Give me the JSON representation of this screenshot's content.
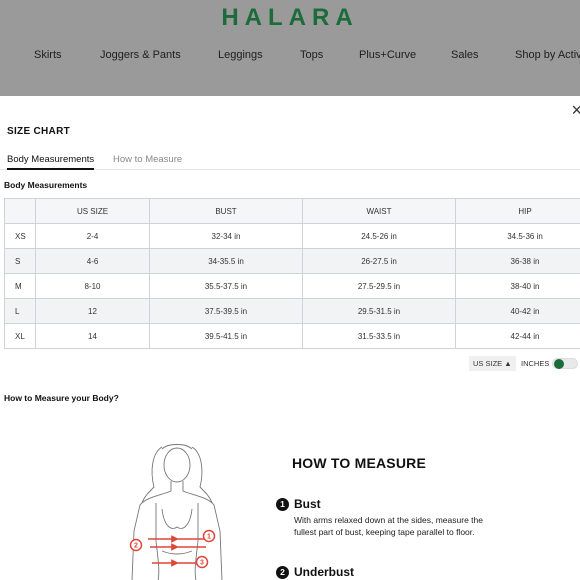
{
  "site": {
    "logo": "HALARA",
    "nav": [
      "Skirts",
      "Joggers & Pants",
      "Leggings",
      "Tops",
      "Plus+Curve",
      "Sales",
      "Shop by Activ"
    ]
  },
  "modal": {
    "close": "×",
    "title": "SIZE CHART",
    "tabs": [
      "Body Measurements",
      "How to Measure"
    ],
    "section_label": "Body Measurements",
    "table": {
      "headers": [
        "",
        "US SIZE",
        "BUST",
        "WAIST",
        "HIP"
      ],
      "rows": [
        [
          "XS",
          "2-4",
          "32-34 in",
          "24.5-26 in",
          "34.5-36 in"
        ],
        [
          "S",
          "4-6",
          "34-35.5 in",
          "26-27.5 in",
          "36-38 in"
        ],
        [
          "M",
          "8-10",
          "35.5-37.5 in",
          "27.5-29.5 in",
          "38-40 in"
        ],
        [
          "L",
          "12",
          "37.5-39.5 in",
          "29.5-31.5 in",
          "40-42 in"
        ],
        [
          "XL",
          "14",
          "39.5-41.5 in",
          "31.5-33.5 in",
          "42-44 in"
        ]
      ]
    },
    "unit_select": "US SIZE",
    "unit_arrow": "▲",
    "inches_label": "INCHES",
    "inches_on": true,
    "how_question": "How to Measure your Body?",
    "how_title": "HOW TO MEASURE",
    "steps": [
      {
        "num": "1",
        "title": "Bust",
        "desc": "With arms relaxed down at the sides, measure the fullest part of bust, keeping tape parallel to floor."
      },
      {
        "num": "2",
        "title": "Underbust"
      }
    ],
    "illustration_markers": [
      "1",
      "2",
      "3"
    ]
  },
  "colors": {
    "brand": "#1c6b3a",
    "overlay": "#9a9a9a",
    "marker": "#e0453a"
  }
}
